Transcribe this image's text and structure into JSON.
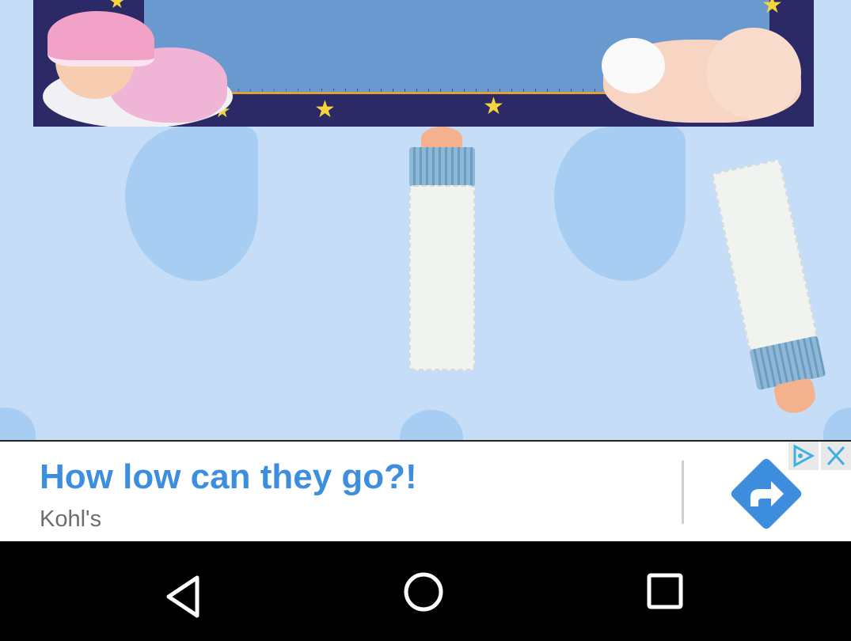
{
  "ad": {
    "title": "How low can they go?!",
    "advertiser": "Kohl's",
    "accent_color": "#3e8ee0",
    "cta_icon": "share-arrow-icon",
    "adchoices_icon": "adchoices-icon",
    "close_icon": "close-icon"
  },
  "navbar": {
    "back_icon": "back-triangle-icon",
    "home_icon": "home-circle-icon",
    "recents_icon": "recents-square-icon"
  },
  "game": {
    "banner": "sleeping-babies-banner",
    "items": [
      "baby-bottle",
      "baby-bottle"
    ],
    "background_color": "#c6ddf7"
  }
}
